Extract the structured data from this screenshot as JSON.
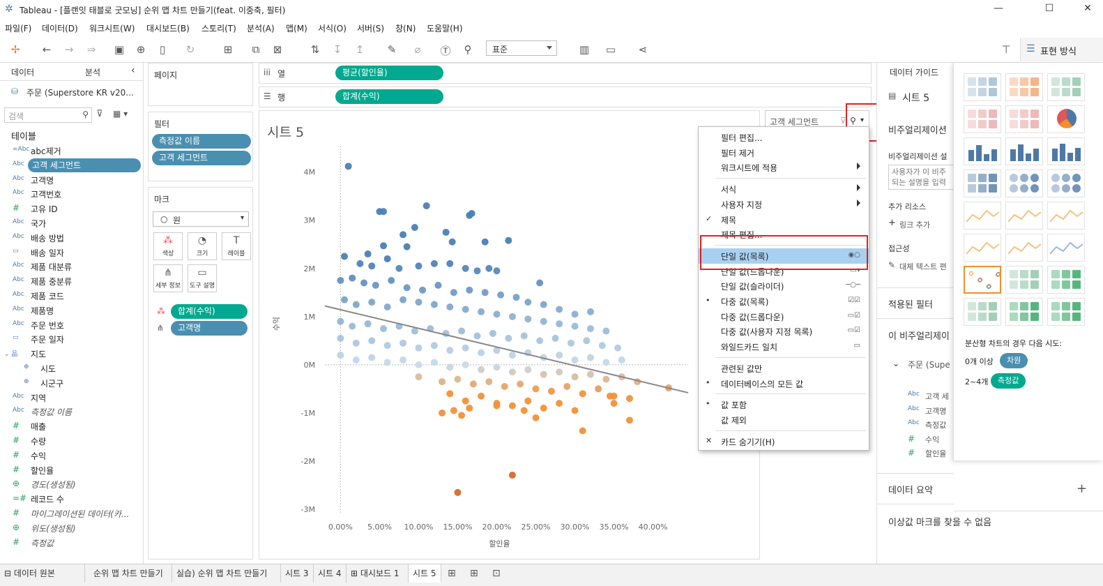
{
  "window": {
    "title": "Tableau - [플랜잇 태블로 굿모닝] 순위 맵 차트 만들기(feat. 이중축, 필터)",
    "minimize": "—",
    "maximize": "☐",
    "close": "✕"
  },
  "menu": [
    "파일(F)",
    "데이터(D)",
    "워크시트(W)",
    "대시보드(B)",
    "스토리(T)",
    "분석(A)",
    "맵(M)",
    "서식(O)",
    "서버(S)",
    "창(N)",
    "도움말(H)"
  ],
  "toolbar": {
    "fit_dropdown": "표준",
    "show_me_label": "표현 방식",
    "icons": [
      "tableau-logo-icon",
      "undo-icon",
      "redo-icon",
      "replay-icon",
      "save-icon",
      "new-datasource-icon",
      "pause-icon",
      "refresh-icon",
      "new-worksheet-icon",
      "duplicate-icon",
      "clear-icon",
      "swap-icon",
      "sort-asc-icon",
      "sort-desc-icon",
      "highlight-icon",
      "group-icon",
      "labels-icon",
      "pin-icon",
      "fit-icon",
      "presentation-icon",
      "share-icon"
    ]
  },
  "left_pane": {
    "tabs": [
      "데이터",
      "분석"
    ],
    "datasource": "주문 (Superstore KR v20...",
    "search_placeholder": "검색",
    "tables_header": "테이블",
    "fields": [
      {
        "type": "=Abc",
        "name": "abc제거",
        "measure": false,
        "italic": false
      },
      {
        "type": "Abc",
        "name": "고객 세그먼트",
        "measure": false,
        "italic": false,
        "selected": true
      },
      {
        "type": "Abc",
        "name": "고객명",
        "measure": false,
        "italic": false
      },
      {
        "type": "Abc",
        "name": "고객번호",
        "measure": false,
        "italic": false
      },
      {
        "type": "#",
        "name": "고유 ID",
        "measure": true,
        "italic": false
      },
      {
        "type": "Abc",
        "name": "국가",
        "measure": false,
        "italic": false
      },
      {
        "type": "Abc",
        "name": "배송 방법",
        "measure": false,
        "italic": false
      },
      {
        "type": "▭",
        "name": "배송 일자",
        "measure": false,
        "italic": false
      },
      {
        "type": "Abc",
        "name": "제품 대분류",
        "measure": false,
        "italic": false
      },
      {
        "type": "Abc",
        "name": "제품 중분류",
        "measure": false,
        "italic": false
      },
      {
        "type": "Abc",
        "name": "제품 코드",
        "measure": false,
        "italic": false
      },
      {
        "type": "Abc",
        "name": "제품명",
        "measure": false,
        "italic": false
      },
      {
        "type": "Abc",
        "name": "주문 번호",
        "measure": false,
        "italic": false
      },
      {
        "type": "▭",
        "name": "주문 일자",
        "measure": false,
        "italic": false
      },
      {
        "type": "⌄ 品",
        "name": "지도",
        "measure": false,
        "italic": false
      },
      {
        "type": "⊕",
        "name": "시도",
        "measure": false,
        "italic": false,
        "indent": true
      },
      {
        "type": "⊕",
        "name": "시군구",
        "measure": false,
        "italic": false,
        "indent": true
      },
      {
        "type": "Abc",
        "name": "지역",
        "measure": false,
        "italic": false
      },
      {
        "type": "Abc",
        "name": "측정값 이름",
        "measure": false,
        "italic": true
      },
      {
        "type": "#",
        "name": "매출",
        "measure": true,
        "italic": false
      },
      {
        "type": "#",
        "name": "수량",
        "measure": true,
        "italic": false
      },
      {
        "type": "#",
        "name": "수익",
        "measure": true,
        "italic": false
      },
      {
        "type": "#",
        "name": "할인율",
        "measure": true,
        "italic": false
      },
      {
        "type": "⊕",
        "name": "경도(생성됨)",
        "measure": true,
        "italic": true
      },
      {
        "type": "=#",
        "name": "레코드 수",
        "measure": true,
        "italic": false
      },
      {
        "type": "#",
        "name": "마이그레이션된 데이터(카...",
        "measure": true,
        "italic": true
      },
      {
        "type": "⊕",
        "name": "위도(생성됨)",
        "measure": true,
        "italic": true
      },
      {
        "type": "#",
        "name": "측정값",
        "measure": true,
        "italic": true
      }
    ]
  },
  "cards": {
    "pages_title": "페이지",
    "filters_title": "필터",
    "filters": [
      "측정값 이름",
      "고객 세그먼트"
    ],
    "marks_title": "마크",
    "mark_type": "원",
    "mark_buttons": [
      {
        "label": "색상",
        "icon": "color-icon"
      },
      {
        "label": "크기",
        "icon": "size-icon"
      },
      {
        "label": "레이블",
        "icon": "label-icon"
      },
      {
        "label": "세부 정보",
        "icon": "detail-icon"
      },
      {
        "label": "도구 설명",
        "icon": "tooltip-icon"
      }
    ],
    "mark_pills": [
      "합계(수익)",
      "고객명"
    ]
  },
  "shelves": {
    "columns_label": "열",
    "columns_pill": "평균(할인율)",
    "rows_label": "행",
    "rows_pill": "합계(수익)"
  },
  "sheet": {
    "title": "시트 5",
    "legend_title": "고객 세그먼트"
  },
  "chart_data": {
    "type": "scatter",
    "title": "",
    "xlabel": "할인율",
    "ylabel": "수익",
    "xlim": [
      -0.02,
      0.445
    ],
    "ylim": [
      -3.1,
      4.4
    ],
    "x_ticks": [
      "0.00%",
      "5.00%",
      "10.00%",
      "15.00%",
      "20.00%",
      "25.00%",
      "30.00%",
      "35.00%",
      "40.00%"
    ],
    "x_tick_values": [
      0,
      0.05,
      0.1,
      0.15,
      0.2,
      0.25,
      0.3,
      0.35,
      0.4
    ],
    "y_ticks": [
      "4M",
      "3M",
      "2M",
      "1M",
      "0M",
      "-1M",
      "-2M",
      "-3M"
    ],
    "y_tick_values": [
      4,
      3,
      2,
      1,
      0,
      -1,
      -2,
      -3
    ],
    "color_positive": "#4a7fb5",
    "color_light": "#c8dbe9",
    "color_negative": "#f0923a",
    "trend_line": {
      "x": [
        -0.02,
        0.445
      ],
      "y": [
        1.22,
        -0.58
      ]
    },
    "points": [
      [
        0.01,
        4.12
      ],
      [
        0.05,
        3.18
      ],
      [
        0.055,
        3.18
      ],
      [
        0.11,
        3.3
      ],
      [
        0.165,
        3.1
      ],
      [
        0.168,
        3.14
      ],
      [
        0.095,
        2.85
      ],
      [
        0.08,
        2.7
      ],
      [
        0.135,
        2.75
      ],
      [
        0.143,
        2.55
      ],
      [
        0.185,
        2.55
      ],
      [
        0.215,
        2.58
      ],
      [
        0.055,
        2.47
      ],
      [
        0.035,
        2.3
      ],
      [
        0.085,
        2.45
      ],
      [
        0.005,
        2.25
      ],
      [
        0.025,
        2.1
      ],
      [
        0.04,
        2.05
      ],
      [
        0.06,
        2.2
      ],
      [
        0.075,
        2.0
      ],
      [
        0.1,
        2.05
      ],
      [
        0.12,
        2.1
      ],
      [
        0.14,
        2.1
      ],
      [
        0.16,
        2.0
      ],
      [
        0.175,
        1.95
      ],
      [
        0.19,
        2.0
      ],
      [
        0.2,
        1.95
      ],
      [
        0.255,
        1.7
      ],
      [
        0.0,
        1.75
      ],
      [
        0.015,
        1.8
      ],
      [
        0.03,
        1.7
      ],
      [
        0.045,
        1.65
      ],
      [
        0.065,
        1.75
      ],
      [
        0.085,
        1.6
      ],
      [
        0.105,
        1.55
      ],
      [
        0.125,
        1.65
      ],
      [
        0.145,
        1.5
      ],
      [
        0.165,
        1.55
      ],
      [
        0.185,
        1.5
      ],
      [
        0.205,
        1.45
      ],
      [
        0.225,
        1.4
      ],
      [
        0.24,
        1.3
      ],
      [
        0.26,
        1.25
      ],
      [
        0.28,
        1.15
      ],
      [
        0.3,
        1.05
      ],
      [
        0.32,
        1.1
      ],
      [
        0.005,
        1.35
      ],
      [
        0.02,
        1.25
      ],
      [
        0.04,
        1.3
      ],
      [
        0.06,
        1.2
      ],
      [
        0.08,
        1.35
      ],
      [
        0.1,
        1.3
      ],
      [
        0.12,
        1.25
      ],
      [
        0.14,
        1.2
      ],
      [
        0.16,
        1.15
      ],
      [
        0.18,
        1.1
      ],
      [
        0.2,
        1.05
      ],
      [
        0.22,
        1.0
      ],
      [
        0.24,
        0.95
      ],
      [
        0.26,
        0.9
      ],
      [
        0.28,
        0.85
      ],
      [
        0.3,
        0.8
      ],
      [
        0.32,
        0.75
      ],
      [
        0.34,
        0.7
      ],
      [
        0.0,
        0.9
      ],
      [
        0.015,
        0.8
      ],
      [
        0.035,
        0.85
      ],
      [
        0.055,
        0.75
      ],
      [
        0.075,
        0.8
      ],
      [
        0.095,
        0.7
      ],
      [
        0.115,
        0.75
      ],
      [
        0.135,
        0.65
      ],
      [
        0.155,
        0.7
      ],
      [
        0.175,
        0.6
      ],
      [
        0.195,
        0.65
      ],
      [
        0.215,
        0.55
      ],
      [
        0.235,
        0.6
      ],
      [
        0.255,
        0.5
      ],
      [
        0.275,
        0.55
      ],
      [
        0.295,
        0.45
      ],
      [
        0.315,
        0.5
      ],
      [
        0.335,
        0.4
      ],
      [
        0.355,
        0.35
      ],
      [
        0.0,
        0.55
      ],
      [
        0.02,
        0.45
      ],
      [
        0.04,
        0.5
      ],
      [
        0.06,
        0.4
      ],
      [
        0.08,
        0.45
      ],
      [
        0.1,
        0.35
      ],
      [
        0.12,
        0.4
      ],
      [
        0.14,
        0.3
      ],
      [
        0.16,
        0.35
      ],
      [
        0.18,
        0.25
      ],
      [
        0.2,
        0.3
      ],
      [
        0.22,
        0.2
      ],
      [
        0.24,
        0.25
      ],
      [
        0.26,
        0.15
      ],
      [
        0.28,
        0.2
      ],
      [
        0.3,
        0.1
      ],
      [
        0.32,
        0.15
      ],
      [
        0.34,
        0.05
      ],
      [
        0.36,
        0.1
      ],
      [
        0.0,
        0.2
      ],
      [
        0.02,
        0.1
      ],
      [
        0.04,
        0.15
      ],
      [
        0.06,
        0.05
      ],
      [
        0.08,
        0.1
      ],
      [
        0.1,
        0.0
      ],
      [
        0.12,
        0.05
      ],
      [
        0.14,
        -0.05
      ],
      [
        0.16,
        0.0
      ],
      [
        0.18,
        -0.1
      ],
      [
        0.2,
        -0.05
      ],
      [
        0.22,
        -0.15
      ],
      [
        0.24,
        -0.1
      ],
      [
        0.26,
        -0.2
      ],
      [
        0.28,
        -0.15
      ],
      [
        0.3,
        -0.25
      ],
      [
        0.32,
        -0.2
      ],
      [
        0.34,
        -0.3
      ],
      [
        0.36,
        -0.25
      ],
      [
        0.38,
        -0.35
      ],
      [
        0.42,
        -0.48
      ],
      [
        0.1,
        -0.25
      ],
      [
        0.13,
        -0.35
      ],
      [
        0.15,
        -0.3
      ],
      [
        0.17,
        -0.4
      ],
      [
        0.19,
        -0.35
      ],
      [
        0.21,
        -0.45
      ],
      [
        0.23,
        -0.4
      ],
      [
        0.25,
        -0.5
      ],
      [
        0.27,
        -0.55
      ],
      [
        0.29,
        -0.45
      ],
      [
        0.31,
        -0.6
      ],
      [
        0.33,
        -0.5
      ],
      [
        0.35,
        -0.65
      ],
      [
        0.37,
        -0.7
      ],
      [
        0.14,
        -0.6
      ],
      [
        0.16,
        -0.75
      ],
      [
        0.18,
        -0.65
      ],
      [
        0.2,
        -0.8
      ],
      [
        0.22,
        -0.85
      ],
      [
        0.24,
        -0.75
      ],
      [
        0.26,
        -0.9
      ],
      [
        0.28,
        -0.8
      ],
      [
        0.3,
        -0.95
      ],
      [
        0.345,
        -0.65
      ],
      [
        0.35,
        -0.8
      ],
      [
        0.37,
        -1.15
      ],
      [
        0.145,
        -0.95
      ],
      [
        0.155,
        -1.05
      ],
      [
        0.165,
        -0.9
      ],
      [
        0.2,
        -0.85
      ],
      [
        0.235,
        -0.95
      ],
      [
        0.25,
        -1.1
      ],
      [
        0.31,
        -1.37
      ],
      [
        0.22,
        -2.29
      ],
      [
        0.15,
        -2.65
      ],
      [
        0.13,
        -1.0
      ]
    ]
  },
  "context_menu": {
    "items": [
      {
        "label": "필터 편집...",
        "check": "",
        "arrow": false,
        "right": ""
      },
      {
        "label": "필터 제거",
        "check": "",
        "arrow": false,
        "right": ""
      },
      {
        "label": "워크시트에 적용",
        "check": "",
        "arrow": true,
        "right": ""
      },
      {
        "sep": true
      },
      {
        "label": "서식",
        "check": "",
        "arrow": true,
        "right": ""
      },
      {
        "label": "사용자 지정",
        "check": "",
        "arrow": true,
        "right": ""
      },
      {
        "label": "제목",
        "check": "✓",
        "arrow": false,
        "right": ""
      },
      {
        "label": "제목 편집...",
        "check": "",
        "arrow": false,
        "right": ""
      },
      {
        "sep": true
      },
      {
        "label": "단일 값(목록)",
        "check": "",
        "arrow": false,
        "right": "◉○",
        "highlight": true
      },
      {
        "label": "단일 값(드롭다운)",
        "check": "",
        "arrow": false,
        "right": "▭▾"
      },
      {
        "label": "단일 값(슬라이더)",
        "check": "",
        "arrow": false,
        "right": "─○─"
      },
      {
        "label": "다중 값(목록)",
        "check": "•",
        "arrow": false,
        "right": "☑☑"
      },
      {
        "label": "다중 값(드롭다운)",
        "check": "",
        "arrow": false,
        "right": "▭☑"
      },
      {
        "label": "다중 값(사용자 지정 목록)",
        "check": "",
        "arrow": false,
        "right": "▭☑"
      },
      {
        "label": "와일드카드 일치",
        "check": "",
        "arrow": false,
        "right": "▭"
      },
      {
        "sep": true
      },
      {
        "label": "관련된 값만",
        "check": "",
        "arrow": false,
        "right": ""
      },
      {
        "label": "데이터베이스의 모든 값",
        "check": "•",
        "arrow": false,
        "right": ""
      },
      {
        "sep": true
      },
      {
        "label": "값 포함",
        "check": "•",
        "arrow": false,
        "right": ""
      },
      {
        "label": "값 제외",
        "check": "",
        "arrow": false,
        "right": ""
      },
      {
        "sep": true
      },
      {
        "label": "카드 숨기기(H)",
        "check": "✕",
        "arrow": false,
        "right": ""
      }
    ]
  },
  "right_pane": {
    "header": "데이터 가이드",
    "sheet": "시트 5",
    "viz_title": "비주얼리제이션",
    "viz_desc_label": "비주얼리제이션 설",
    "viz_desc_placeholder": "사용자가 이 비주 되는 설명을 입력",
    "resources": "추가 리소스",
    "add_link": "링크 추가",
    "accessibility": "접근성",
    "alt_text": "대체 텍스트 편",
    "applied_filters": "적용된 필터",
    "this_viz": "이 비주얼리제이",
    "source": "주문 (Supe",
    "source_fields": [
      {
        "icon": "Abc",
        "name": "고객 세"
      },
      {
        "icon": "Abc",
        "name": "고객명"
      },
      {
        "icon": "Abc",
        "name": "측정값"
      },
      {
        "icon": "#",
        "name": "수익"
      },
      {
        "icon": "#",
        "name": "할인율"
      }
    ],
    "data_summary": "데이터 요약",
    "no_outliers": "이상값 마크를 찾을 수 없음"
  },
  "show_me": {
    "hint": "분산형 차트의 경우 다음 시도:",
    "req1_label": "0개 이상",
    "req1_pill": "차원",
    "req2_label": "2~4개",
    "req2_pill": "측정값",
    "thumbnails": [
      "text-table",
      "heat-map",
      "highlight-table",
      "symbol-map",
      "filled-map",
      "pie-chart",
      "horizontal-bars",
      "stacked-bars",
      "side-by-side-bars",
      "treemap",
      "circle-views",
      "side-by-side-circles",
      "lines-continuous",
      "lines-discrete",
      "dual-lines",
      "area-continuous",
      "area-discrete",
      "dual-combination",
      "scatter-plot",
      "histogram",
      "box-and-whisker",
      "gantt",
      "bullet-graph",
      "packed-bubbles"
    ],
    "selected": "scatter-plot"
  },
  "bottom_tabs": [
    "데이터 원본",
    "순위 맵 차트 만들기",
    "실습) 순위 맵 차트 만들기",
    "시트 3",
    "시트 4",
    "대시보드 1",
    "시트 5"
  ],
  "active_tab": "시트 5"
}
